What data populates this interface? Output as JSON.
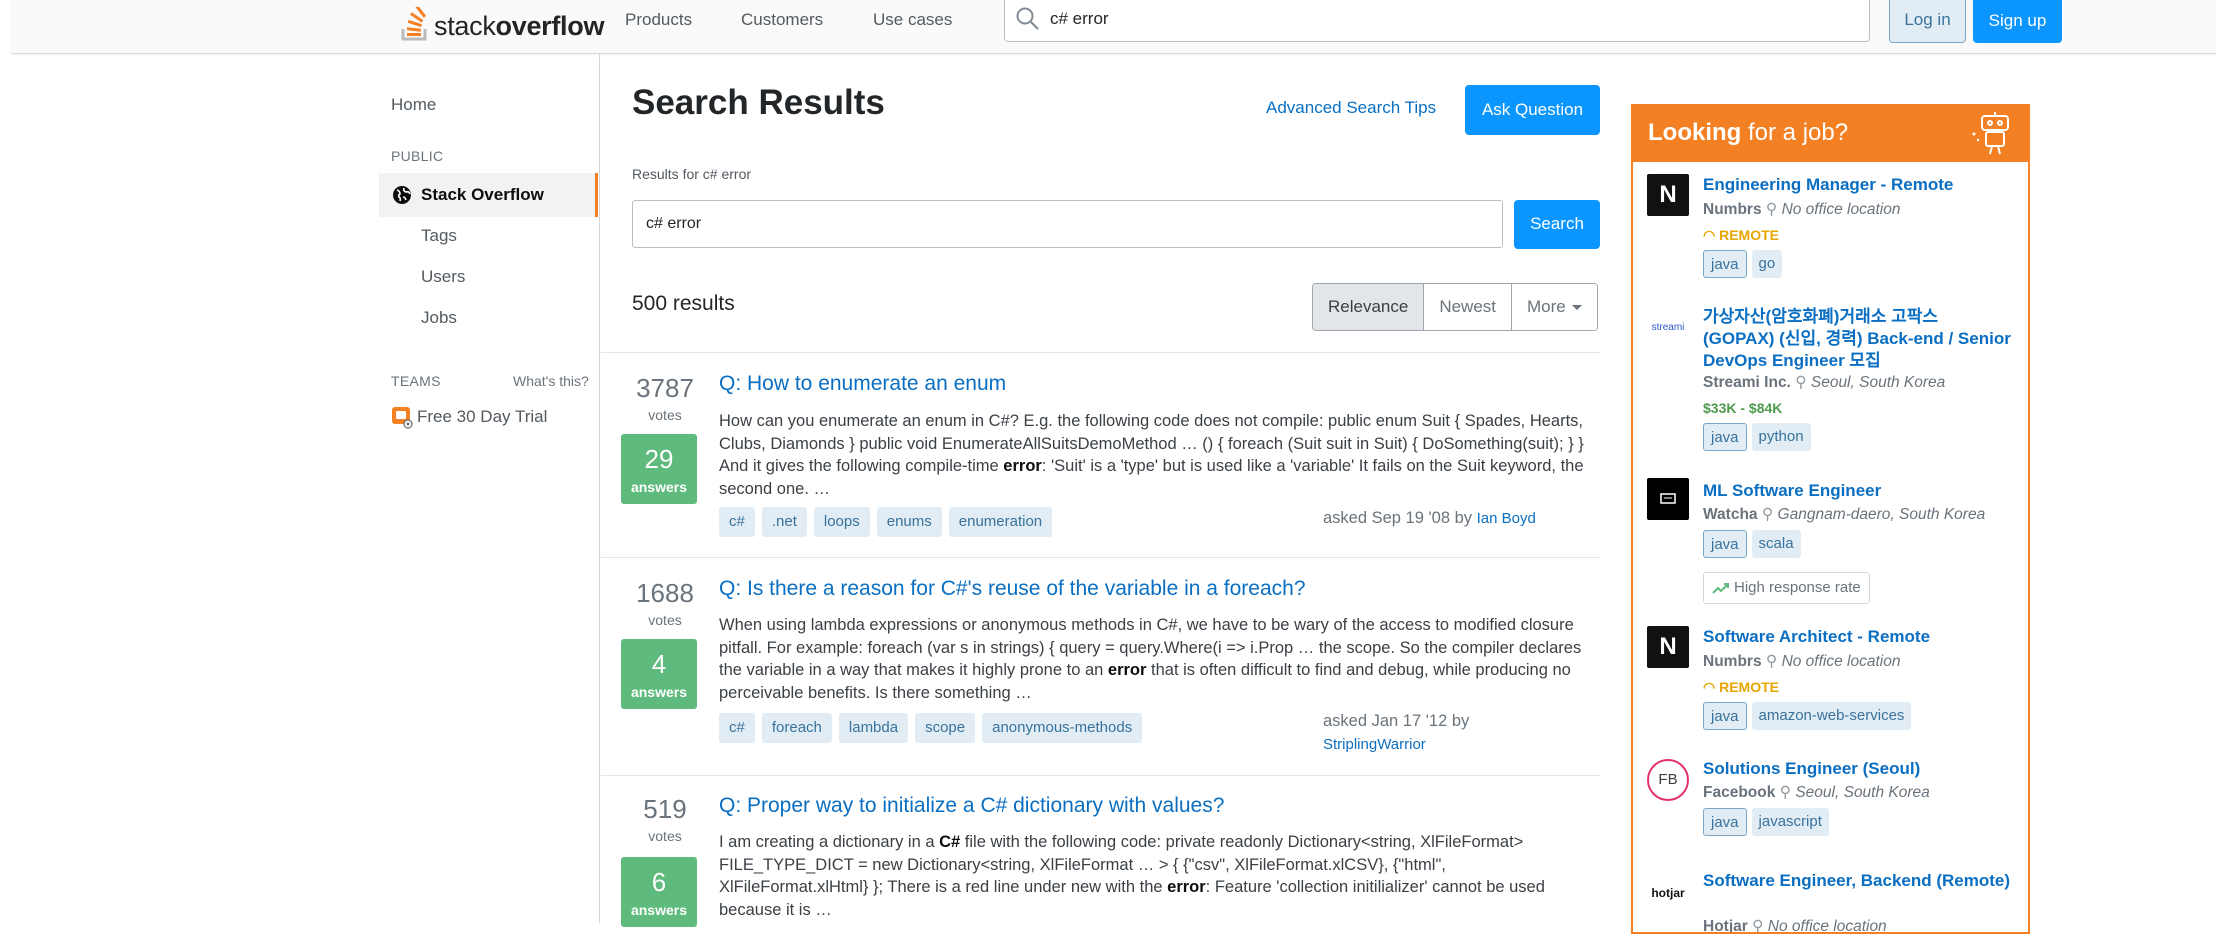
{
  "header": {
    "logo_light": "stack",
    "logo_bold": "overflow",
    "nav": [
      "Products",
      "Customers",
      "Use cases"
    ],
    "search_value": "c# error",
    "login_label": "Log in",
    "signup_label": "Sign up"
  },
  "sidebar": {
    "home": "Home",
    "public_heading": "PUBLIC",
    "stack_overflow": "Stack Overflow",
    "tags": "Tags",
    "users": "Users",
    "jobs": "Jobs",
    "teams_heading": "TEAMS",
    "whats_this": "What's this?",
    "free_trial": "Free 30 Day Trial"
  },
  "main": {
    "title": "Search Results",
    "advanced_tips": "Advanced Search Tips",
    "ask_question": "Ask Question",
    "results_for": "Results for c# error",
    "search_value": "c# error",
    "search_button": "Search",
    "result_count": "500 results",
    "sort_tabs": [
      "Relevance",
      "Newest",
      "More"
    ],
    "active_sort": "Relevance"
  },
  "results": [
    {
      "votes": "3787",
      "votes_label": "votes",
      "answers": "29",
      "answers_label": "answers",
      "title": "Q: How to enumerate an enum",
      "excerpt_html": "How can you enumerate an enum in C#? E.g. the following code does not compile: public enum Suit { Spades, Hearts, Clubs, Diamonds } public void EnumerateAllSuitsDemoMethod … () { foreach (Suit suit in Suit) { DoSomething(suit); } } And it gives the following compile-time <b>error</b>: 'Suit' is a 'type' but is used like a 'variable' It fails on the Suit keyword, the second one. …",
      "tags": [
        "c#",
        ".net",
        "loops",
        "enums",
        "enumeration"
      ],
      "asked": "asked Sep 19 '08 by",
      "user": "Ian Boyd"
    },
    {
      "votes": "1688",
      "votes_label": "votes",
      "answers": "4",
      "answers_label": "answers",
      "title": "Q: Is there a reason for C#'s reuse of the variable in a foreach?",
      "excerpt_html": "When using lambda expressions or anonymous methods in C#, we have to be wary of the access to modified closure pitfall. For example: foreach (var s in strings) { query = query.Where(i => i.Prop … the scope. So the compiler declares the variable in a way that makes it highly prone to an <b>error</b> that is often difficult to find and debug, while producing no perceivable benefits. Is there something …",
      "tags": [
        "c#",
        "foreach",
        "lambda",
        "scope",
        "anonymous-methods"
      ],
      "asked": "asked Jan 17 '12 by",
      "user": "StriplingWarrior"
    },
    {
      "votes": "519",
      "votes_label": "votes",
      "answers": "6",
      "answers_label": "answers",
      "title": "Q: Proper way to initialize a C# dictionary with values?",
      "excerpt_html": "I am creating a dictionary in a <b>C#</b> file with the following code: private readonly Dictionary&lt;string, XlFileFormat&gt; FILE_TYPE_DICT = new Dictionary&lt;string, XlFileFormat … &gt; { {\"csv\", XlFileFormat.xlCSV}, {\"html\", XlFileFormat.xlHtml} }; There is a red line under new with the <b>error</b>: Feature 'collection initilializer' cannot be used because it is …"
    }
  ],
  "jobs": {
    "heading_bold": "Looking",
    "heading_rest": " for a job?",
    "items": [
      {
        "title": "Engineering Manager - Remote",
        "company": "Numbrs",
        "location": "No office location",
        "remote": "REMOTE",
        "tags": [
          "java",
          "go"
        ],
        "logo_text": "N"
      },
      {
        "title": "가상자산(암호화폐)거래소 고팍스 (GOPAX) (신입, 경력) Back-end / Senior DevOps Engineer 모집",
        "company": "Streami Inc.",
        "location": "Seoul, South Korea",
        "salary": "$33K - $84K",
        "tags": [
          "java",
          "python"
        ],
        "logo_text": "streami"
      },
      {
        "title": "ML Software Engineer",
        "company": "Watcha",
        "location": "Gangnam-daero, South Korea",
        "tags": [
          "java",
          "scala"
        ],
        "badge": "High response rate"
      },
      {
        "title": "Software Architect - Remote",
        "company": "Numbrs",
        "location": "No office location",
        "remote": "REMOTE",
        "tags": [
          "java",
          "amazon-web-services"
        ],
        "logo_text": "N"
      },
      {
        "title": "Solutions Engineer (Seoul)",
        "company": "Facebook",
        "location": "Seoul, South Korea",
        "tags": [
          "java",
          "javascript"
        ],
        "logo_text": "FB"
      },
      {
        "title": "Software Engineer, Backend (Remote)",
        "company": "Hotjar",
        "location": "No office location",
        "logo_text": "hotjar"
      }
    ]
  },
  "colors": {
    "accent_orange": "#f48024",
    "primary_blue": "#0a95ff",
    "link_blue": "#0a6fc2",
    "answered_green": "#5eba7d"
  }
}
